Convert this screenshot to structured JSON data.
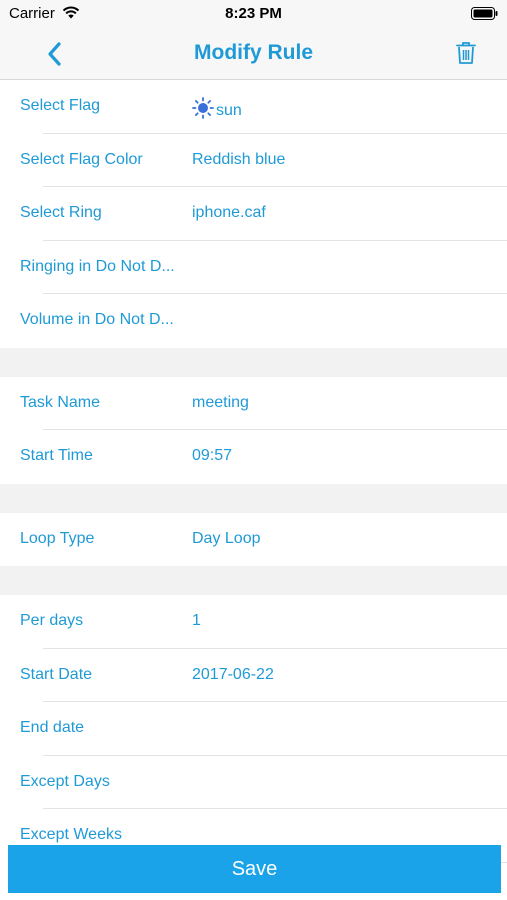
{
  "status_bar": {
    "carrier": "Carrier",
    "time": "8:23 PM"
  },
  "nav": {
    "title": "Modify Rule"
  },
  "sections": [
    {
      "rows": [
        {
          "label": "Select Flag",
          "value": "sun",
          "icon": "sun-icon"
        },
        {
          "label": "Select Flag Color",
          "value": "Reddish blue"
        },
        {
          "label": "Select Ring",
          "value": "iphone.caf"
        },
        {
          "label": "Ringing in Do Not D...",
          "value": ""
        },
        {
          "label": "Volume in Do Not D...",
          "value": ""
        }
      ]
    },
    {
      "rows": [
        {
          "label": "Task Name",
          "value": "meeting"
        },
        {
          "label": "Start Time",
          "value": "09:57"
        }
      ]
    },
    {
      "rows": [
        {
          "label": "Loop Type",
          "value": "Day Loop"
        }
      ]
    },
    {
      "rows": [
        {
          "label": "Per days",
          "value": "1"
        },
        {
          "label": "Start Date",
          "value": "2017-06-22"
        },
        {
          "label": "End date",
          "value": ""
        },
        {
          "label": "Except Days",
          "value": ""
        },
        {
          "label": "Except Weeks",
          "value": ""
        }
      ]
    }
  ],
  "save_label": "Save",
  "colors": {
    "accent": "#1f9ad6",
    "save_button": "#1aa3e8",
    "sun_icon": "#3a6fd8"
  }
}
